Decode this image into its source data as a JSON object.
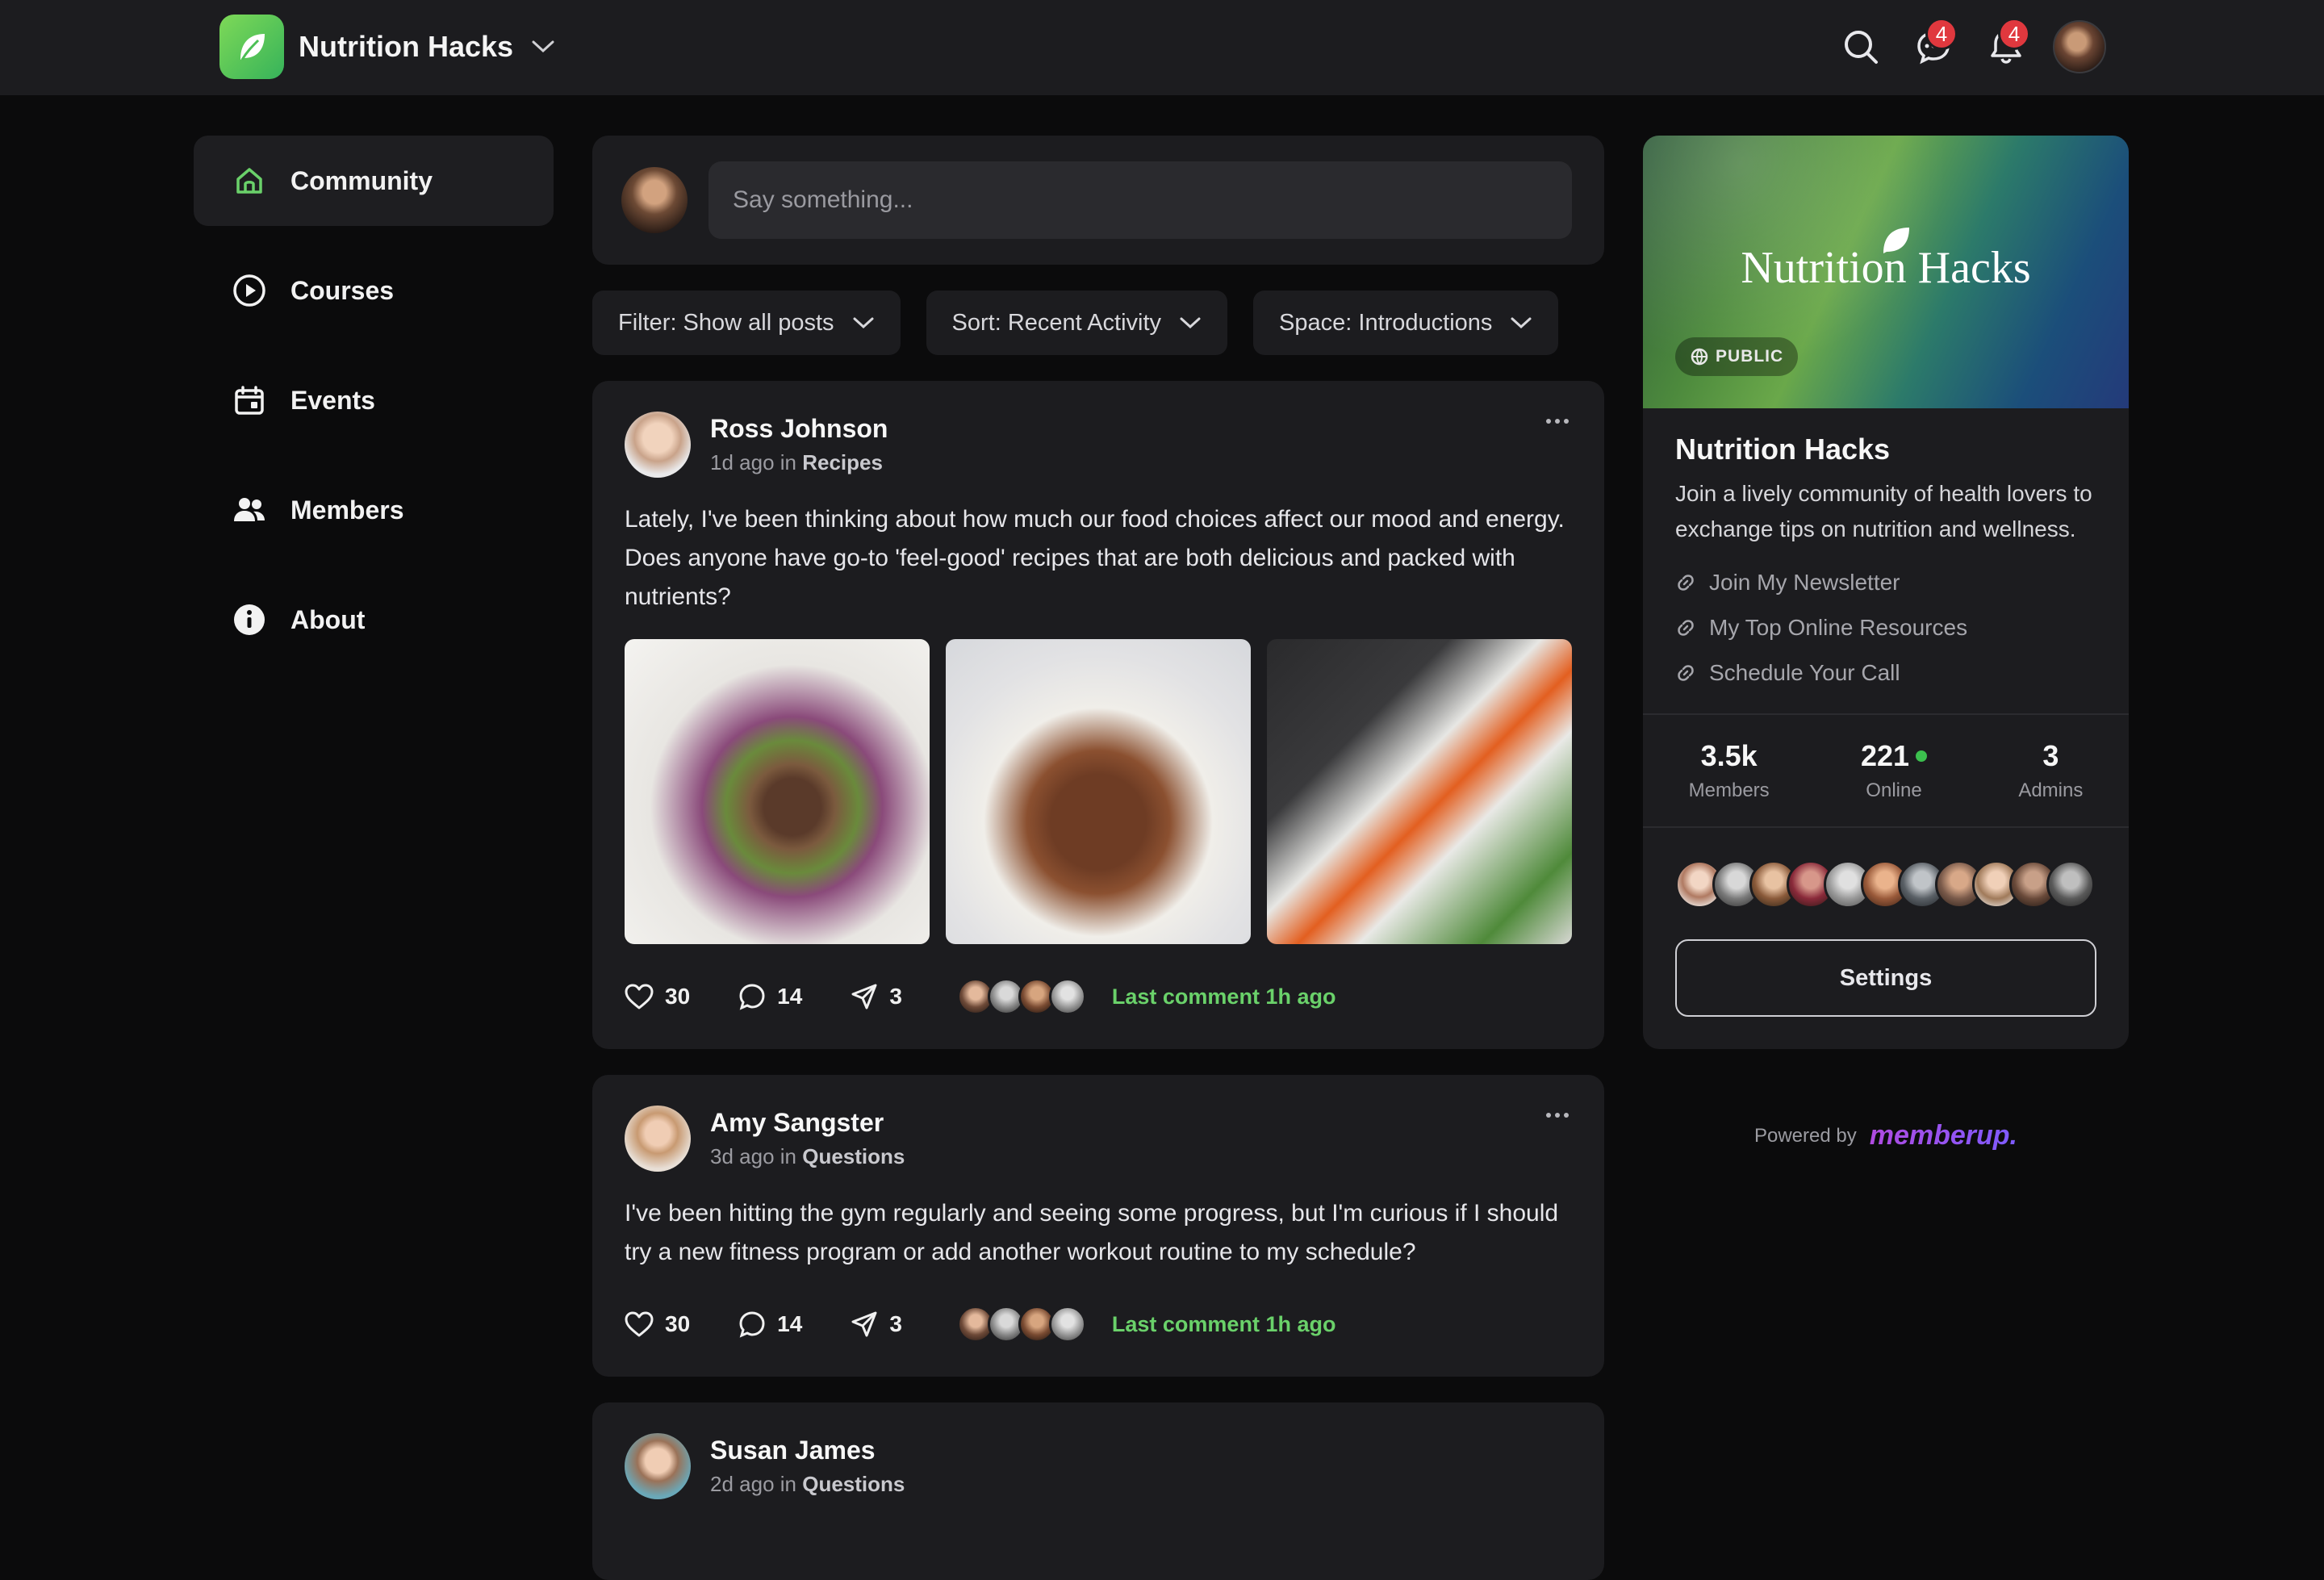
{
  "header": {
    "app_name": "Nutrition Hacks",
    "messages_badge": "4",
    "notifications_badge": "4"
  },
  "sidebar": {
    "items": [
      {
        "label": "Community",
        "icon": "home-icon",
        "active": true
      },
      {
        "label": "Courses",
        "icon": "play-circle-icon"
      },
      {
        "label": "Events",
        "icon": "calendar-icon"
      },
      {
        "label": "Members",
        "icon": "users-icon"
      },
      {
        "label": "About",
        "icon": "info-icon"
      }
    ]
  },
  "composer": {
    "placeholder": "Say something..."
  },
  "filters": {
    "filter": "Filter: Show all posts",
    "sort": "Sort: Recent Activity",
    "space": "Space: Introductions"
  },
  "posts": [
    {
      "author": "Ross Johnson",
      "time": "1d ago in",
      "space": "Recipes",
      "text": "Lately, I've been thinking about how much our food choices affect our mood and energy. Does anyone have go-to 'feel-good' recipes that are both delicious and packed with nutrients?",
      "likes": "30",
      "comments": "14",
      "shares": "3",
      "last_comment": "Last comment 1h ago"
    },
    {
      "author": "Amy Sangster",
      "time": "3d ago in",
      "space": "Questions",
      "text": "I've been hitting the gym regularly and seeing some progress, but I'm curious if I should try a new fitness program or add another workout routine to my schedule?",
      "likes": "30",
      "comments": "14",
      "shares": "3",
      "last_comment": "Last comment 1h ago"
    },
    {
      "author": "Susan James",
      "time": "2d ago in",
      "space": "Questions"
    }
  ],
  "panel": {
    "banner_title": "Nutrition Hacks",
    "visibility": "PUBLIC",
    "title": "Nutrition Hacks",
    "description": "Join a lively community of health lovers to exchange tips on nutrition and wellness.",
    "links": [
      "Join My Newsletter",
      "My Top Online Resources",
      "Schedule Your Call"
    ],
    "stats": {
      "members_value": "3.5k",
      "members_label": "Members",
      "online_value": "221",
      "online_label": "Online",
      "admins_value": "3",
      "admins_label": "Admins"
    },
    "settings_label": "Settings"
  },
  "footer": {
    "powered_by": "Powered by",
    "brand": "memberup."
  },
  "colors": {
    "background": "#0b0b0c",
    "surface": "#1c1c1f",
    "accent_green": "#6ad16a",
    "badge_red": "#e0383e",
    "online_green": "#3cc04e"
  }
}
